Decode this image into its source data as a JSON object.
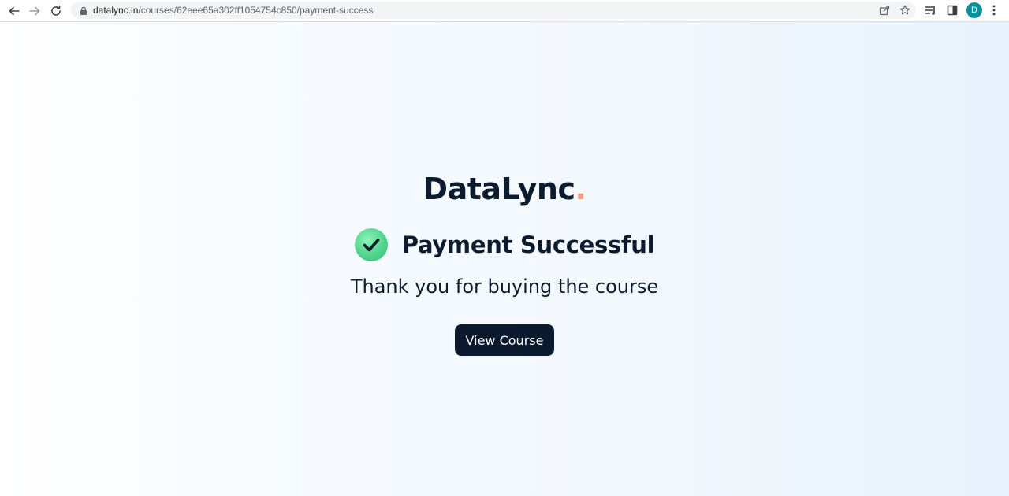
{
  "browser": {
    "url_domain": "datalync.in",
    "url_path": "/courses/62eee65a302ff1054754c850/payment-success",
    "profile_initial": "D"
  },
  "icons": {
    "back": "back-arrow-icon",
    "forward": "forward-arrow-icon",
    "reload": "reload-icon",
    "lock": "lock-icon",
    "share": "share-icon",
    "bookmark": "star-icon",
    "reading_list": "reading-list-icon",
    "side_panel": "side-panel-icon",
    "menu": "kebab-menu-icon",
    "success": "check-circle-icon"
  },
  "page": {
    "logo_text": "DataLync",
    "logo_dot": ".",
    "status_title": "Payment Successful",
    "subtitle": "Thank you for buying the course",
    "cta_label": "View Course"
  },
  "colors": {
    "brand_dark": "#0d1b2e",
    "logo_accent": "#f0a07a",
    "success_green": "#52d38d",
    "button_bg": "#0b1a2e",
    "avatar_bg": "#0b8f9c"
  }
}
